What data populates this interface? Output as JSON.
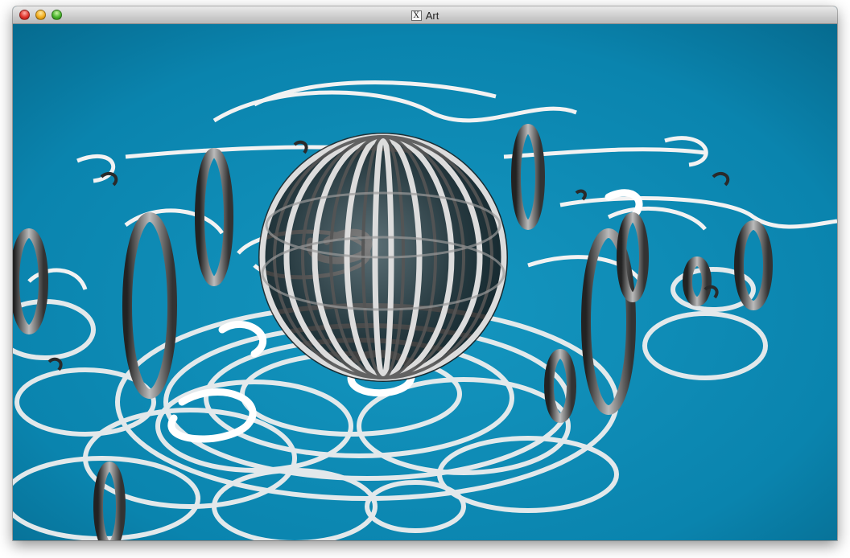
{
  "window": {
    "title": "Art",
    "app_icon_glyph": "X",
    "controls": {
      "close": "close-icon",
      "minimize": "minimize-icon",
      "zoom": "zoom-icon"
    }
  },
  "canvas": {
    "background_color": "#0a86b0",
    "ribbon_color": "#f2f2f2",
    "dark_ribbon_color": "#3a3a3a"
  }
}
